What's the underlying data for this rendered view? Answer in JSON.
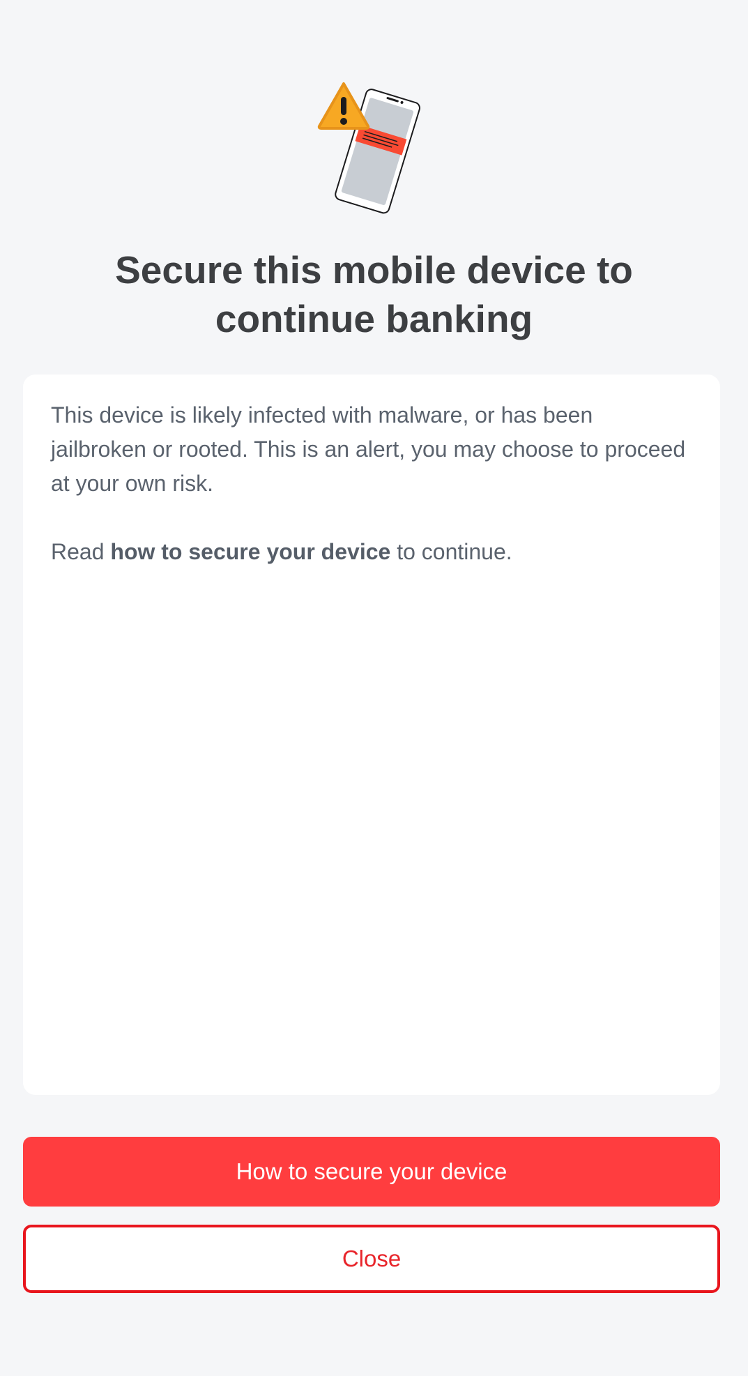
{
  "illustration": {
    "icon": "warning-phone-illustration",
    "colors": {
      "warning": "#f7a823",
      "alert_bar": "#f94a33",
      "screen": "#c8cdd3"
    }
  },
  "title": "Secure this mobile device to continue banking",
  "card": {
    "paragraph1": "This device is likely infected with malware, or has been jailbroken or rooted. This is an alert, you may choose to proceed at your own risk.",
    "paragraph2_prefix": "Read ",
    "paragraph2_bold": "how to secure your device",
    "paragraph2_suffix": " to continue."
  },
  "buttons": {
    "primary_label": "How to secure your device",
    "secondary_label": "Close"
  },
  "colors": {
    "background": "#f5f6f8",
    "primary": "#ff3d3f",
    "secondary_border": "#e8151d",
    "title_text": "#3d3f42",
    "body_text": "#5a626d"
  }
}
